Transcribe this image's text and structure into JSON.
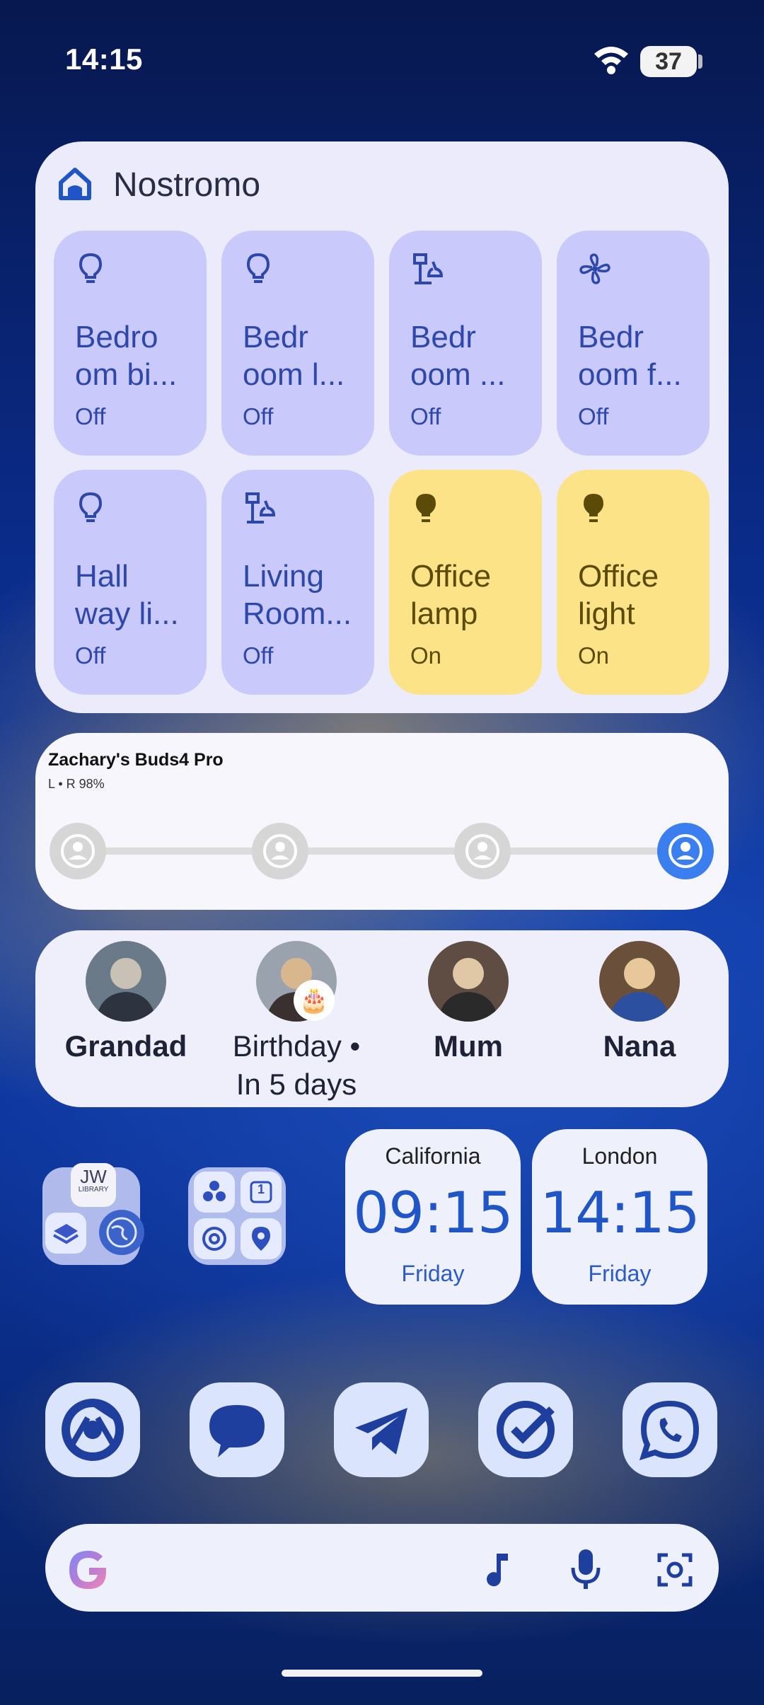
{
  "status_bar": {
    "time": "14:15",
    "battery": "37"
  },
  "home": {
    "title": "Nostromo",
    "tiles": [
      {
        "name": "Bedro\nom bi...",
        "state": "Off",
        "icon": "lightbulb-icon",
        "on": false
      },
      {
        "name": "Bedr\noom l...",
        "state": "Off",
        "icon": "lightbulb-icon",
        "on": false
      },
      {
        "name": "Bedr\noom ...",
        "state": "Off",
        "icon": "lamp-icon",
        "on": false
      },
      {
        "name": "Bedr\noom f...",
        "state": "Off",
        "icon": "fan-icon",
        "on": false
      },
      {
        "name": "Hall\nway li...",
        "state": "Off",
        "icon": "lightbulb-icon",
        "on": false
      },
      {
        "name": "Living\nRoom...",
        "state": "Off",
        "icon": "lamp-icon",
        "on": false
      },
      {
        "name": "Office\nlamp",
        "state": "On",
        "icon": "lightbulb-filled-icon",
        "on": true
      },
      {
        "name": "Office\nlight",
        "state": "On",
        "icon": "lightbulb-filled-icon",
        "on": true
      }
    ]
  },
  "buds": {
    "title": "Zachary's Buds4 Pro",
    "battery": "L • R 98%",
    "modes": [
      "noise-cancel-off-icon",
      "ambient-sound-icon",
      "adaptive-icon",
      "noise-cancel-icon"
    ],
    "active_mode": 3
  },
  "contacts": [
    {
      "name": "Grandad",
      "bold": true
    },
    {
      "name": "Birthday •\nIn 5 days",
      "bold": false
    },
    {
      "name": "Mum",
      "bold": true
    },
    {
      "name": "Nana",
      "bold": true
    }
  ],
  "folder1": {
    "label": "JW",
    "sublabel": "LIBRARY"
  },
  "folder2": {
    "calendar_number": "1"
  },
  "clocks": [
    {
      "city": "California",
      "time": "09:15",
      "day": "Friday"
    },
    {
      "city": "London",
      "time": "14:15",
      "day": "Friday"
    }
  ],
  "dock": [
    "chrome-icon",
    "messages-icon",
    "telegram-icon",
    "tasks-icon",
    "whatsapp-icon"
  ],
  "colors": {
    "accent": "#1f55c6",
    "tile_off": "#c9c9fb",
    "tile_on": "#fde387",
    "active_mode": "#3a7ef0"
  }
}
